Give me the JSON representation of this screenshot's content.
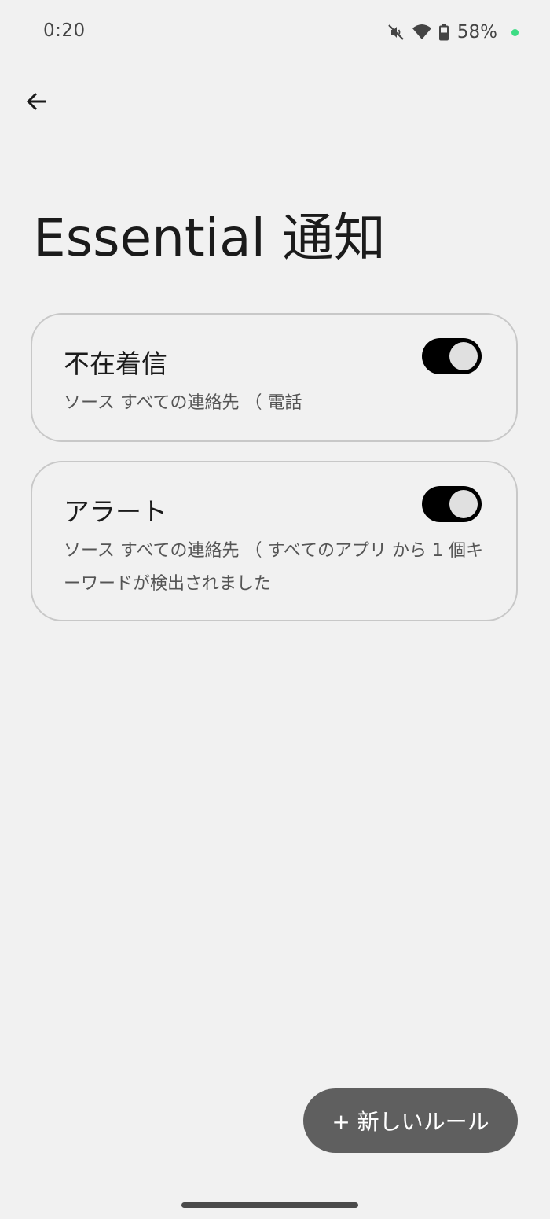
{
  "status_bar": {
    "time": "0:20",
    "battery_percent": "58%",
    "icons": [
      "mute-icon",
      "wifi-icon",
      "battery-icon",
      "privacy-dot"
    ],
    "dot_color": "#3ddc84"
  },
  "header": {
    "back_icon": "arrow-back-icon",
    "title": "Essential 通知"
  },
  "rules": [
    {
      "title": "不在着信",
      "description": "ソース すべての連絡先 （ 電話",
      "enabled": true
    },
    {
      "title": "アラート",
      "description": "ソース すべての連絡先 （ すべてのアプリ から 1 個キーワードが検出されました",
      "enabled": true
    }
  ],
  "actions": {
    "new_rule_label": "+ 新しいルール"
  },
  "colors": {
    "background": "#f1f1f1",
    "toggle_on": "#000000",
    "fab": "#5f5f5f"
  }
}
